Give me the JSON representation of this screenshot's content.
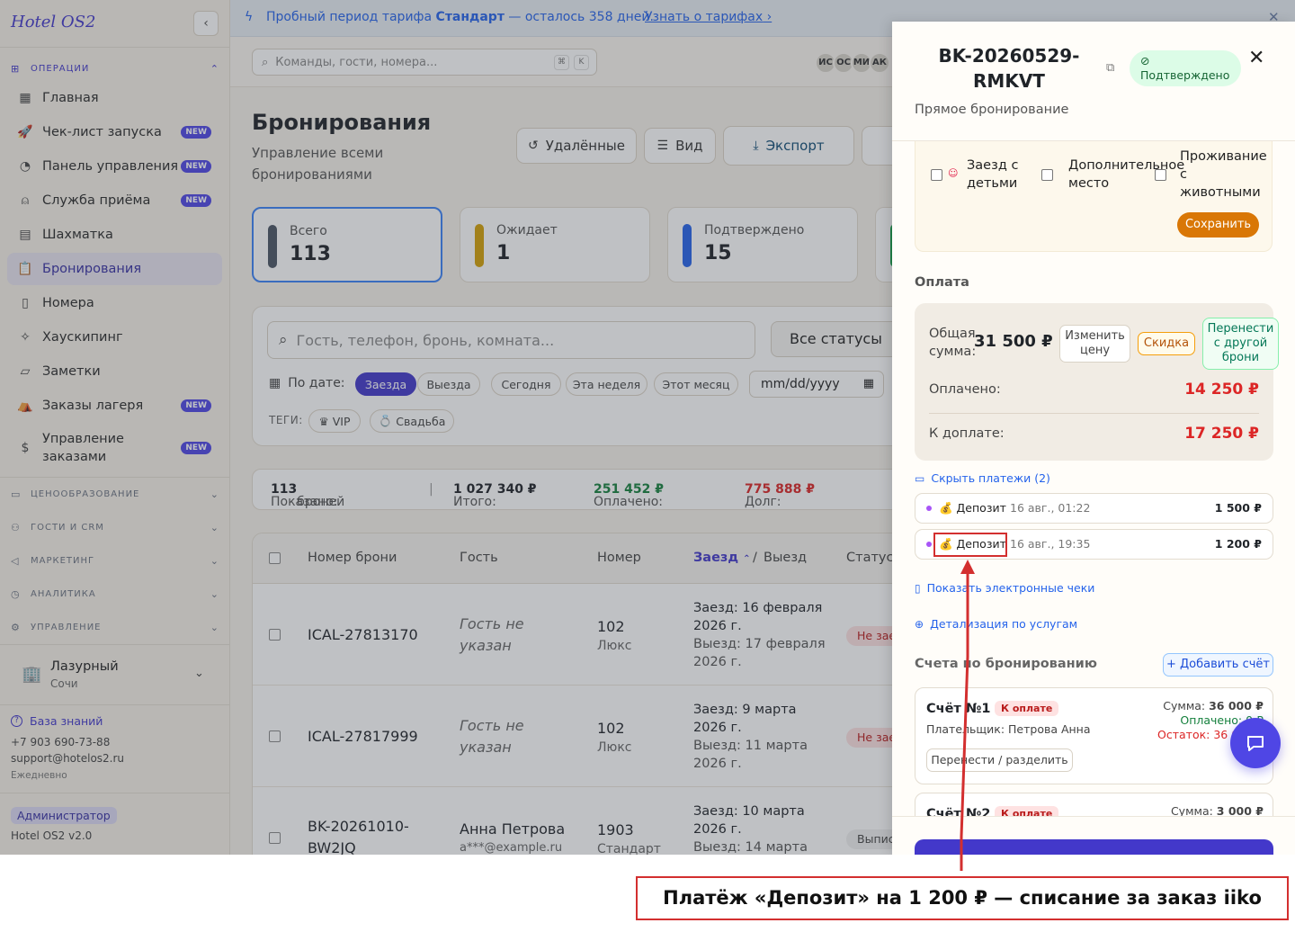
{
  "app": {
    "brand": "Hotel OS2",
    "version": "Hotel OS2 v2.0",
    "role": "Администратор"
  },
  "sidebar": {
    "operations_label": "ОПЕРАЦИИ",
    "items": [
      {
        "label": "Главная",
        "icon": "grid-icon",
        "badge": ""
      },
      {
        "label": "Чек-лист запуска",
        "icon": "rocket-icon",
        "badge": "NEW"
      },
      {
        "label": "Панель управления",
        "icon": "gauge-icon",
        "badge": "NEW"
      },
      {
        "label": "Служба приёма",
        "icon": "bell-icon",
        "badge": "NEW"
      },
      {
        "label": "Шахматка",
        "icon": "table-icon",
        "badge": ""
      },
      {
        "label": "Бронирования",
        "icon": "clipboard-icon",
        "badge": "",
        "active": true
      },
      {
        "label": "Номера",
        "icon": "door-icon",
        "badge": ""
      },
      {
        "label": "Хаускипинг",
        "icon": "sparkle-icon",
        "badge": ""
      },
      {
        "label": "Заметки",
        "icon": "note-icon",
        "badge": ""
      },
      {
        "label": "Заказы лагеря",
        "icon": "tent-icon",
        "badge": "NEW"
      },
      {
        "label": "Управление заказами",
        "icon": "receipt-icon",
        "badge": "NEW"
      }
    ],
    "sections": [
      "ЦЕНООБРАЗОВАНИЕ",
      "ГОСТИ И CRM",
      "МАРКЕТИНГ",
      "АНАЛИТИКА",
      "УПРАВЛЕНИЕ"
    ],
    "hotel": {
      "name": "Лазурный",
      "city": "Сочи"
    },
    "knowledge_base": "База знаний",
    "phone": "+7 903 690-73-88",
    "email": "support@hotelos2.ru",
    "schedule": "Ежедневно"
  },
  "trial": {
    "text_before": "Пробный период тарифа ",
    "plan": "Стандарт",
    "text_after": " — осталось 358 дней.",
    "link": "Узнать о тарифах"
  },
  "topbar": {
    "search_placeholder": "Команды, гости, номера...",
    "shortcut_mod": "⌘",
    "shortcut_key": "K",
    "avatars": [
      "ИС",
      "ОС",
      "МИ",
      "АК"
    ]
  },
  "page": {
    "title": "Бронирования",
    "subtitle": "Управление всеми бронированиями",
    "btn_deleted": "Удалённые",
    "btn_view": "Вид",
    "btn_export": "Экспорт",
    "btn_add": "+"
  },
  "stats": [
    {
      "label": "Всего",
      "value": "113",
      "color": "#4b5563"
    },
    {
      "label": "Ожидает",
      "value": "1",
      "color": "#d4a106"
    },
    {
      "label": "Подтверждено",
      "value": "15",
      "color": "#2563eb"
    },
    {
      "label": "",
      "value": "",
      "color": "#16a34a"
    }
  ],
  "filters": {
    "search_placeholder": "Гость, телефон, бронь, комната...",
    "status": "Все статусы",
    "date_label": "По дате:",
    "date_chips": [
      "Заезда",
      "Выезда",
      "Сегодня",
      "Эта неделя",
      "Этот месяц"
    ],
    "date_placeholder": "mm/dd/yyyy",
    "tags_label": "ТЕГИ:",
    "tags": [
      "VIP",
      "Свадьба"
    ]
  },
  "summary": {
    "shown_label": "Показано:",
    "shown_value": "113",
    "shown_unit": "броней",
    "total_label": "Итого:",
    "total_value": "1 027 340 ₽",
    "paid_label": "Оплачено:",
    "paid_value": "251 452 ₽",
    "debt_label": "Долг:",
    "debt_value": "775 888 ₽"
  },
  "table": {
    "headers": {
      "id": "Номер брони",
      "guest": "Гость",
      "room": "Номер",
      "checkin": "Заезд",
      "sep": "/",
      "checkout": "Выезд",
      "status": "Статус"
    },
    "rows": [
      {
        "id": "ICAL-27813170",
        "guest": "Гость не указан",
        "email": "",
        "room": "102",
        "type": "Люкс",
        "in": "Заезд: 16 февраля 2026 г.",
        "out": "Выезд: 17 февраля 2026 г.",
        "status": "Не заезд"
      },
      {
        "id": "ICAL-27817999",
        "guest": "Гость не указан",
        "email": "",
        "room": "102",
        "type": "Люкс",
        "in": "Заезд: 9 марта 2026 г.",
        "out": "Выезд: 11 марта 2026 г.",
        "status": "Не заезд"
      },
      {
        "id": "BK-20261010-BW2JQ",
        "guest": "Анна Петрова",
        "email": "a***@example.ru",
        "room": "1903",
        "type": "Стандарт",
        "in": "Заезд: 10 марта 2026 г.",
        "out": "Выезд: 14 марта",
        "status": "Выписан"
      }
    ]
  },
  "drawer": {
    "code": "BK-20260529-RMKVT",
    "status": "Подтверждено",
    "source": "Прямое бронирование",
    "prefs": [
      "Заезд с детьми",
      "Дополнительное место",
      "Проживание с животными"
    ],
    "save": "Сохранить",
    "payment_title": "Оплата",
    "total_label": "Общая сумма:",
    "total_value": "31 500 ₽",
    "change_price": "Изменить цену",
    "discount": "Скидка",
    "transfer": "Перенести с другой брони",
    "paid_label": "Оплачено:",
    "paid_value": "14 250 ₽",
    "due_label": "К доплате:",
    "due_value": "17 250 ₽",
    "hide_payments": "Скрыть платежи (2)",
    "payments": [
      {
        "name": "💰 Депозит",
        "date": "16 авг., 01:22",
        "amount": "1 500 ₽"
      },
      {
        "name": "💰 Депозит",
        "date": "16 авг., 19:35",
        "amount": "1 200 ₽"
      }
    ],
    "show_receipts": "Показать электронные чеки",
    "service_details": "Детализация по услугам",
    "invoices_title": "Счета по бронированию",
    "add_invoice": "+ Добавить счёт",
    "invoices": [
      {
        "name": "Счёт №1",
        "badge": "К оплате",
        "payer": "Плательщик: Петрова Анна",
        "sum_label": "Сумма:",
        "sum": "36 000 ₽",
        "paid": "Оплачено: 0 ₽",
        "rest": "Остаток: 36 000 ₽",
        "split": "Перенести / разделить"
      },
      {
        "name": "Счёт №2",
        "badge": "К оплате",
        "sum_label": "Сумма:",
        "sum": "3 000 ₽"
      }
    ]
  },
  "annotation": {
    "caption": "Платёж «Депозит» на 1 200 ₽ — списание за заказ iiko",
    "color": "#d32f2f"
  }
}
